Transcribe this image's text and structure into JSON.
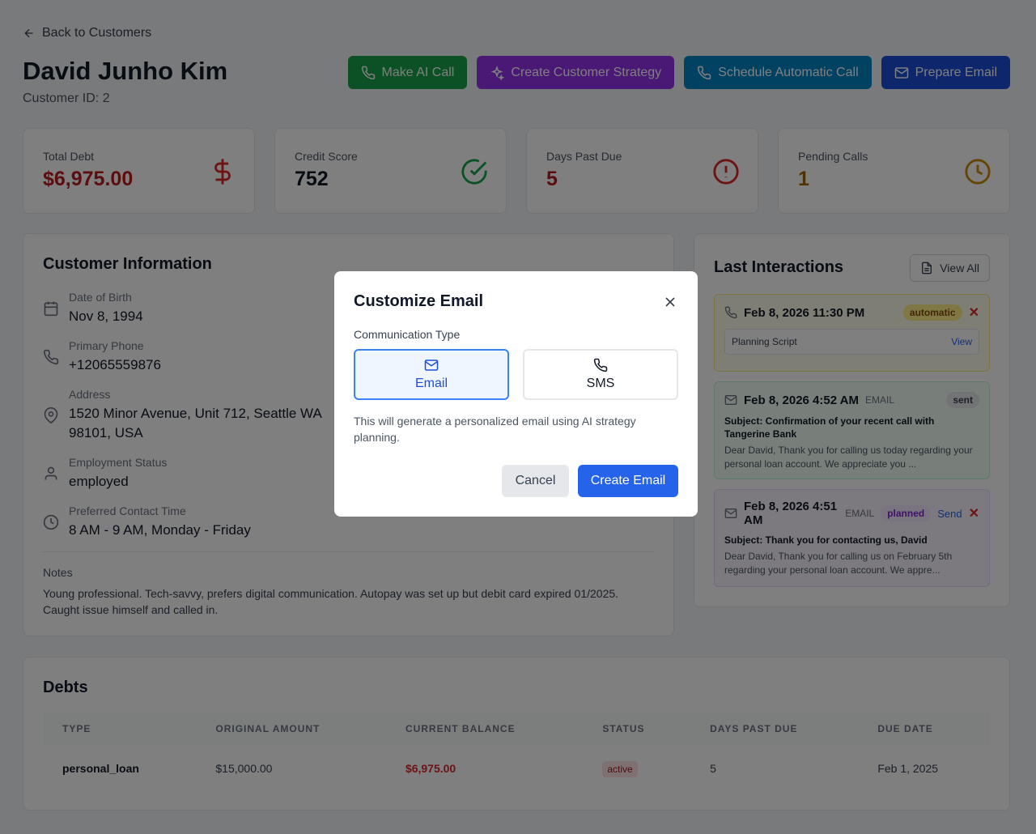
{
  "nav": {
    "back_label": "Back to Customers"
  },
  "customer": {
    "name": "David Junho Kim",
    "id_label": "Customer ID: 2"
  },
  "actions": {
    "ai_call": "Make AI Call",
    "strategy": "Create Customer Strategy",
    "schedule": "Schedule Automatic Call",
    "email": "Prepare Email"
  },
  "stats": [
    {
      "label": "Total Debt",
      "value": "$6,975.00",
      "color": "#b91c1c",
      "icon": "dollar-icon"
    },
    {
      "label": "Credit Score",
      "value": "752",
      "color": "#111827",
      "icon": "check-circle-icon"
    },
    {
      "label": "Days Past Due",
      "value": "5",
      "color": "#b91c1c",
      "icon": "alert-circle-icon"
    },
    {
      "label": "Pending Calls",
      "value": "1",
      "color": "#a16207",
      "icon": "clock-icon"
    }
  ],
  "info": {
    "title": "Customer Information",
    "dob_label": "Date of Birth",
    "dob": "Nov 8, 1994",
    "phone_label": "Primary Phone",
    "phone": "+12065559876",
    "address_label": "Address",
    "address": "1520 Minor Avenue, Unit 712, Seattle WA 98101, USA",
    "employment_label": "Employment Status",
    "employment": "employed",
    "contact_label": "Preferred Contact Time",
    "contact": "8 AM - 9 AM, Monday - Friday",
    "notes_label": "Notes",
    "notes": "Young professional. Tech-savvy, prefers digital communication. Autopay was set up but debit card expired 01/2025. Caught issue himself and called in."
  },
  "interactions": {
    "title": "Last Interactions",
    "view_all": "View All",
    "items": [
      {
        "datetime": "Feb 8, 2026 11:30 PM",
        "tag": "automatic",
        "sub_label": "Planning Script",
        "sub_link": "View"
      },
      {
        "datetime": "Feb 8, 2026 4:52 AM",
        "channel": "EMAIL",
        "tag": "sent",
        "subject": "Subject: Confirmation of your recent call with Tangerine Bank",
        "body": "Dear David, Thank you for calling us today regarding your personal loan account. We appreciate you ..."
      },
      {
        "datetime": "Feb 8, 2026 4:51 AM",
        "channel": "EMAIL",
        "tag": "planned",
        "action": "Send",
        "subject": "Subject: Thank you for contacting us, David",
        "body": "Dear David, Thank you for calling us on February 5th regarding your personal loan account. We appre..."
      }
    ]
  },
  "debts": {
    "title": "Debts",
    "columns": [
      "TYPE",
      "ORIGINAL AMOUNT",
      "CURRENT BALANCE",
      "STATUS",
      "DAYS PAST DUE",
      "DUE DATE"
    ],
    "rows": [
      {
        "type": "personal_loan",
        "original": "$15,000.00",
        "balance": "$6,975.00",
        "status": "active",
        "days": "5",
        "due": "Feb 1, 2025"
      }
    ]
  },
  "modal": {
    "title": "Customize Email",
    "type_label": "Communication Type",
    "option_email": "Email",
    "option_sms": "SMS",
    "selected": "Email",
    "description": "This will generate a personalized email using AI strategy planning.",
    "cancel": "Cancel",
    "create": "Create Email"
  }
}
